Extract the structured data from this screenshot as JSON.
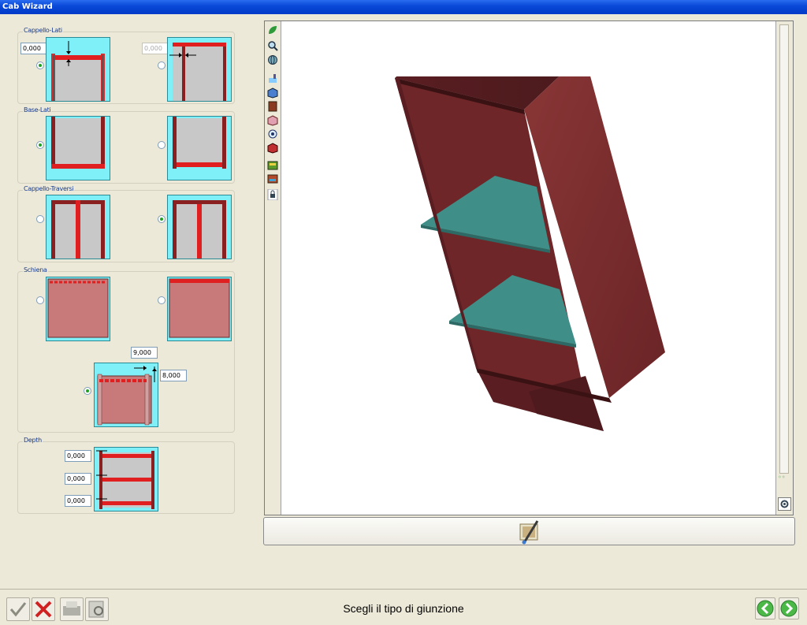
{
  "window": {
    "title": "Cab Wizard"
  },
  "groups": {
    "cappello_lati": {
      "label": "Cappello-Lati",
      "value1": "0,000",
      "value2": "0,000",
      "option1_selected": true,
      "option2_selected": false
    },
    "base_lati": {
      "label": "Base-Lati",
      "option1_selected": true,
      "option2_selected": false
    },
    "cappello_traversi": {
      "label": "Cappello-Traversi",
      "option1_selected": false,
      "option2_selected": true
    },
    "schiena": {
      "label": "Schiena",
      "value_width": "9,000",
      "value_depth": "8,000",
      "option1_selected": false,
      "option2_selected": false,
      "option3_selected": true
    },
    "depth": {
      "label": "Depth",
      "values": [
        "0,000",
        "0,000",
        "0,000"
      ]
    }
  },
  "status": {
    "text": "Scegli il tipo di giunzione"
  },
  "colors": {
    "panel_cyan": "#7ff0f8",
    "board_red": "#e02020",
    "wood": "#7a2a2c",
    "shelf": "#3f8f88"
  },
  "toolbar_icons": [
    "leaf-icon",
    "zoom-icon",
    "globe-icon",
    "paint-icon",
    "cube-blue-icon",
    "material-brown-icon",
    "cube-pink-icon",
    "eye-icon",
    "cube-red-icon",
    "texture-icon",
    "texture2-icon",
    "lock-icon"
  ]
}
